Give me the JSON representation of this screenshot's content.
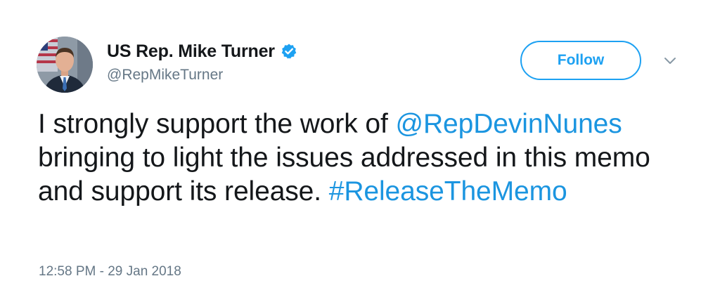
{
  "author": {
    "display_name": "US Rep. Mike Turner",
    "handle": "@RepMikeTurner",
    "verified": true,
    "avatar_icon": "profile-photo"
  },
  "follow_button": {
    "label": "Follow"
  },
  "menu": {
    "icon": "chevron-down-icon"
  },
  "tweet": {
    "text_part1": "I strongly support the work of ",
    "mention": "@RepDevinNunes",
    "text_part2": " bringing to light the issues addressed in this memo and support its release. ",
    "hashtag": "#ReleaseTheMemo"
  },
  "timestamp": "12:58 PM - 29 Jan 2018",
  "colors": {
    "accent": "#1da1f2",
    "link": "#1b95e0",
    "text": "#14171a",
    "secondary": "#657786"
  }
}
